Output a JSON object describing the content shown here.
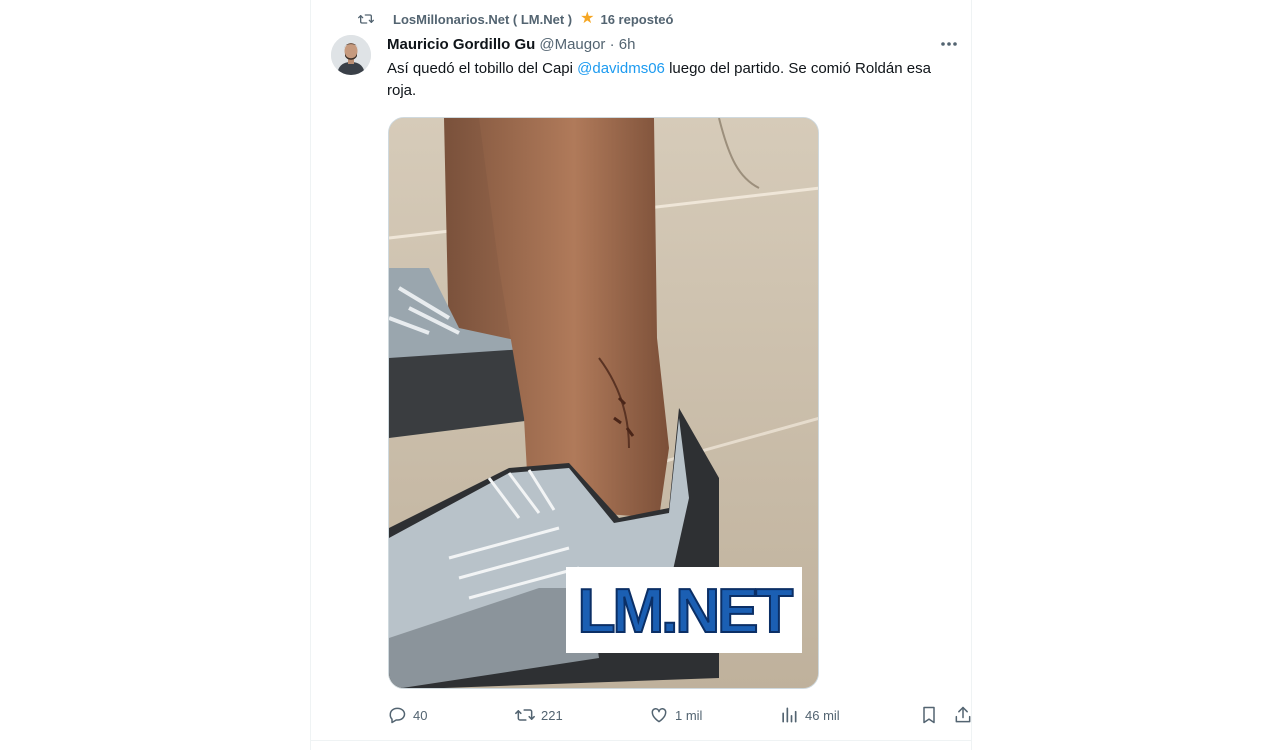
{
  "repost": {
    "reposter_name": "LosMillonarios.Net ( LM.Net )",
    "suffix": "16 reposteó",
    "icon": "retweet-icon",
    "star_icon": "star-icon"
  },
  "tweet": {
    "author_name": "Mauricio Gordillo Gu",
    "author_meta": "@Maugor · 6h",
    "text_before": "Así quedó el tobillo del Capi ",
    "mention": "@davidms06",
    "text_after": " luego del partido. Se comió Roldán esa roja.",
    "media_watermark": "LM.NET",
    "more_icon": "more-icon"
  },
  "actions": {
    "reply": {
      "icon": "reply-icon",
      "count": "40"
    },
    "retweet": {
      "icon": "retweet-icon",
      "count": "221"
    },
    "like": {
      "icon": "heart-icon",
      "count": "1 mil"
    },
    "views": {
      "icon": "views-icon",
      "count": "46 mil"
    },
    "bookmark": {
      "icon": "bookmark-icon"
    },
    "share": {
      "icon": "share-icon"
    }
  },
  "colors": {
    "accent": "#1d9bf0",
    "muted": "#536471",
    "text": "#0f1419",
    "star": "#f5a623",
    "watermark_blue": "#1b5fb3"
  }
}
